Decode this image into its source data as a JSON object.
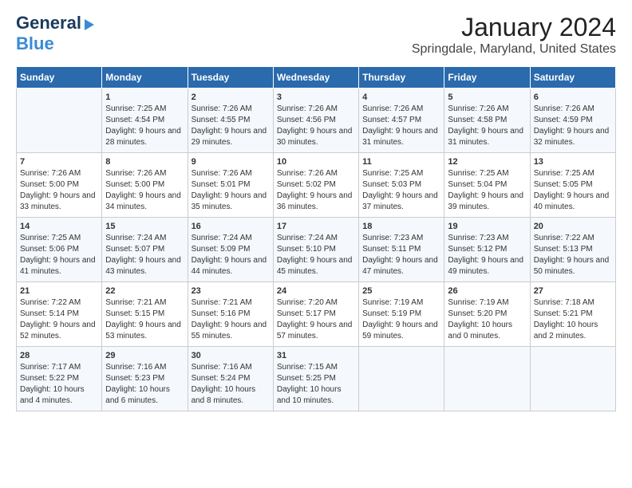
{
  "header": {
    "logo_line1": "General",
    "logo_line2": "Blue",
    "title": "January 2024",
    "subtitle": "Springdale, Maryland, United States"
  },
  "columns": [
    "Sunday",
    "Monday",
    "Tuesday",
    "Wednesday",
    "Thursday",
    "Friday",
    "Saturday"
  ],
  "weeks": [
    [
      {
        "day": "",
        "sunrise": "",
        "sunset": "",
        "daylight": ""
      },
      {
        "day": "1",
        "sunrise": "Sunrise: 7:25 AM",
        "sunset": "Sunset: 4:54 PM",
        "daylight": "Daylight: 9 hours and 28 minutes."
      },
      {
        "day": "2",
        "sunrise": "Sunrise: 7:26 AM",
        "sunset": "Sunset: 4:55 PM",
        "daylight": "Daylight: 9 hours and 29 minutes."
      },
      {
        "day": "3",
        "sunrise": "Sunrise: 7:26 AM",
        "sunset": "Sunset: 4:56 PM",
        "daylight": "Daylight: 9 hours and 30 minutes."
      },
      {
        "day": "4",
        "sunrise": "Sunrise: 7:26 AM",
        "sunset": "Sunset: 4:57 PM",
        "daylight": "Daylight: 9 hours and 31 minutes."
      },
      {
        "day": "5",
        "sunrise": "Sunrise: 7:26 AM",
        "sunset": "Sunset: 4:58 PM",
        "daylight": "Daylight: 9 hours and 31 minutes."
      },
      {
        "day": "6",
        "sunrise": "Sunrise: 7:26 AM",
        "sunset": "Sunset: 4:59 PM",
        "daylight": "Daylight: 9 hours and 32 minutes."
      }
    ],
    [
      {
        "day": "7",
        "sunrise": "Sunrise: 7:26 AM",
        "sunset": "Sunset: 5:00 PM",
        "daylight": "Daylight: 9 hours and 33 minutes."
      },
      {
        "day": "8",
        "sunrise": "Sunrise: 7:26 AM",
        "sunset": "Sunset: 5:00 PM",
        "daylight": "Daylight: 9 hours and 34 minutes."
      },
      {
        "day": "9",
        "sunrise": "Sunrise: 7:26 AM",
        "sunset": "Sunset: 5:01 PM",
        "daylight": "Daylight: 9 hours and 35 minutes."
      },
      {
        "day": "10",
        "sunrise": "Sunrise: 7:26 AM",
        "sunset": "Sunset: 5:02 PM",
        "daylight": "Daylight: 9 hours and 36 minutes."
      },
      {
        "day": "11",
        "sunrise": "Sunrise: 7:25 AM",
        "sunset": "Sunset: 5:03 PM",
        "daylight": "Daylight: 9 hours and 37 minutes."
      },
      {
        "day": "12",
        "sunrise": "Sunrise: 7:25 AM",
        "sunset": "Sunset: 5:04 PM",
        "daylight": "Daylight: 9 hours and 39 minutes."
      },
      {
        "day": "13",
        "sunrise": "Sunrise: 7:25 AM",
        "sunset": "Sunset: 5:05 PM",
        "daylight": "Daylight: 9 hours and 40 minutes."
      }
    ],
    [
      {
        "day": "14",
        "sunrise": "Sunrise: 7:25 AM",
        "sunset": "Sunset: 5:06 PM",
        "daylight": "Daylight: 9 hours and 41 minutes."
      },
      {
        "day": "15",
        "sunrise": "Sunrise: 7:24 AM",
        "sunset": "Sunset: 5:07 PM",
        "daylight": "Daylight: 9 hours and 43 minutes."
      },
      {
        "day": "16",
        "sunrise": "Sunrise: 7:24 AM",
        "sunset": "Sunset: 5:09 PM",
        "daylight": "Daylight: 9 hours and 44 minutes."
      },
      {
        "day": "17",
        "sunrise": "Sunrise: 7:24 AM",
        "sunset": "Sunset: 5:10 PM",
        "daylight": "Daylight: 9 hours and 45 minutes."
      },
      {
        "day": "18",
        "sunrise": "Sunrise: 7:23 AM",
        "sunset": "Sunset: 5:11 PM",
        "daylight": "Daylight: 9 hours and 47 minutes."
      },
      {
        "day": "19",
        "sunrise": "Sunrise: 7:23 AM",
        "sunset": "Sunset: 5:12 PM",
        "daylight": "Daylight: 9 hours and 49 minutes."
      },
      {
        "day": "20",
        "sunrise": "Sunrise: 7:22 AM",
        "sunset": "Sunset: 5:13 PM",
        "daylight": "Daylight: 9 hours and 50 minutes."
      }
    ],
    [
      {
        "day": "21",
        "sunrise": "Sunrise: 7:22 AM",
        "sunset": "Sunset: 5:14 PM",
        "daylight": "Daylight: 9 hours and 52 minutes."
      },
      {
        "day": "22",
        "sunrise": "Sunrise: 7:21 AM",
        "sunset": "Sunset: 5:15 PM",
        "daylight": "Daylight: 9 hours and 53 minutes."
      },
      {
        "day": "23",
        "sunrise": "Sunrise: 7:21 AM",
        "sunset": "Sunset: 5:16 PM",
        "daylight": "Daylight: 9 hours and 55 minutes."
      },
      {
        "day": "24",
        "sunrise": "Sunrise: 7:20 AM",
        "sunset": "Sunset: 5:17 PM",
        "daylight": "Daylight: 9 hours and 57 minutes."
      },
      {
        "day": "25",
        "sunrise": "Sunrise: 7:19 AM",
        "sunset": "Sunset: 5:19 PM",
        "daylight": "Daylight: 9 hours and 59 minutes."
      },
      {
        "day": "26",
        "sunrise": "Sunrise: 7:19 AM",
        "sunset": "Sunset: 5:20 PM",
        "daylight": "Daylight: 10 hours and 0 minutes."
      },
      {
        "day": "27",
        "sunrise": "Sunrise: 7:18 AM",
        "sunset": "Sunset: 5:21 PM",
        "daylight": "Daylight: 10 hours and 2 minutes."
      }
    ],
    [
      {
        "day": "28",
        "sunrise": "Sunrise: 7:17 AM",
        "sunset": "Sunset: 5:22 PM",
        "daylight": "Daylight: 10 hours and 4 minutes."
      },
      {
        "day": "29",
        "sunrise": "Sunrise: 7:16 AM",
        "sunset": "Sunset: 5:23 PM",
        "daylight": "Daylight: 10 hours and 6 minutes."
      },
      {
        "day": "30",
        "sunrise": "Sunrise: 7:16 AM",
        "sunset": "Sunset: 5:24 PM",
        "daylight": "Daylight: 10 hours and 8 minutes."
      },
      {
        "day": "31",
        "sunrise": "Sunrise: 7:15 AM",
        "sunset": "Sunset: 5:25 PM",
        "daylight": "Daylight: 10 hours and 10 minutes."
      },
      {
        "day": "",
        "sunrise": "",
        "sunset": "",
        "daylight": ""
      },
      {
        "day": "",
        "sunrise": "",
        "sunset": "",
        "daylight": ""
      },
      {
        "day": "",
        "sunrise": "",
        "sunset": "",
        "daylight": ""
      }
    ]
  ]
}
